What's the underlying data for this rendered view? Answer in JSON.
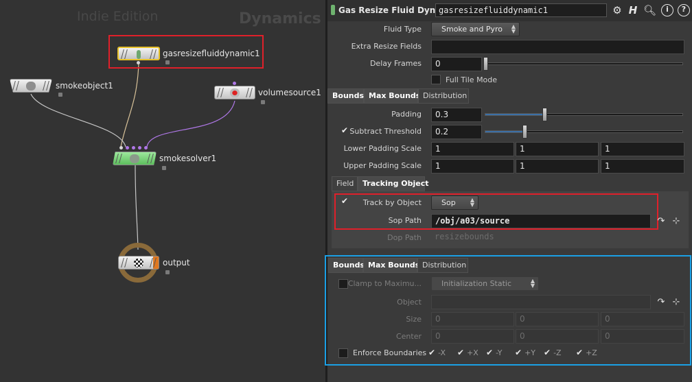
{
  "network": {
    "edition": "Indie Edition",
    "context": "Dynamics",
    "nodes": {
      "resize": "gasresizefluiddynamic1",
      "smokeobject": "smokeobject1",
      "volumesource": "volumesource1",
      "smokesolver": "smokesolver1",
      "output": "output"
    }
  },
  "params": {
    "node_type": "Gas Resize Fluid Dynamic",
    "node_name": "gasresizefluiddynamic1",
    "toolbar_icons": [
      "gear-icon",
      "help-h-icon",
      "search-icon",
      "info-icon",
      "question-icon"
    ],
    "fluid_type": {
      "label": "Fluid Type",
      "value": "Smoke and Pyro"
    },
    "extra_resize_fields": {
      "label": "Extra Resize Fields",
      "value": ""
    },
    "delay_frames": {
      "label": "Delay Frames",
      "value": "0"
    },
    "full_tile_mode": {
      "label": "Full Tile Mode"
    },
    "tabs1": [
      "Bounds",
      "Max Bounds",
      "Distribution"
    ],
    "padding": {
      "label": "Padding",
      "value": "0.3",
      "level": 0.3
    },
    "subtract_threshold": {
      "label": "Subtract Threshold",
      "value": "0.2",
      "level": 0.2
    },
    "lower_padding_scale": {
      "label": "Lower Padding Scale",
      "values": [
        "1",
        "1",
        "1"
      ]
    },
    "upper_padding_scale": {
      "label": "Upper Padding Scale",
      "values": [
        "1",
        "1",
        "1"
      ]
    },
    "subtabs": [
      "Field",
      "Tracking Object"
    ],
    "track_by_object": {
      "label": "Track by Object",
      "value": "Sop"
    },
    "sop_path": {
      "label": "Sop Path",
      "value": "/obj/a03/source"
    },
    "dop_path": {
      "label": "Dop Path",
      "value": "resizebounds"
    },
    "tabs2": [
      "Bounds",
      "Max Bounds",
      "Distribution"
    ],
    "clamp": {
      "label": "Clamp to Maximu...",
      "value": "Initialization Static"
    },
    "object": {
      "label": "Object",
      "value": ""
    },
    "size": {
      "label": "Size",
      "values": [
        "0",
        "0",
        "0"
      ]
    },
    "center": {
      "label": "Center",
      "values": [
        "0",
        "0",
        "0"
      ]
    },
    "enforce_boundaries": {
      "label": "Enforce Boundaries",
      "axes": [
        "-X",
        "+X",
        "-Y",
        "+Y",
        "-Z",
        "+Z"
      ]
    }
  },
  "colors": {
    "highlight_red": "#e0202a",
    "highlight_blue": "#1aa0e6",
    "slider_fill": "#3b6fa6",
    "solver_node": "#7fd67f"
  }
}
